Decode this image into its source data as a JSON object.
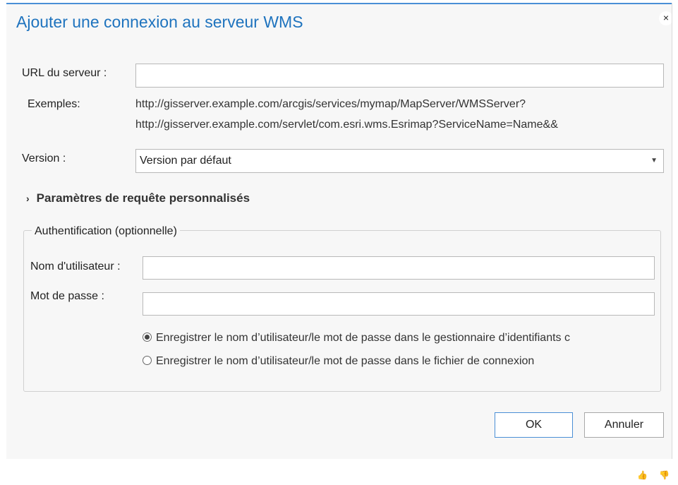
{
  "dialog": {
    "title": "Ajouter une connexion au serveur WMS",
    "close_glyph": "×"
  },
  "url": {
    "label": "URL du serveur :",
    "value": ""
  },
  "examples": {
    "label": "Exemples:",
    "line1": "http://gisserver.example.com/arcgis/services/mymap/MapServer/WMSServer?",
    "line2": "http://gisserver.example.com/servlet/com.esri.wms.Esrimap?ServiceName=Name&&"
  },
  "version": {
    "label": "Version :",
    "selected": "Version par défaut",
    "caret": "▼"
  },
  "custom_params": {
    "chevron": "›",
    "label": "Paramètres de requête personnalisés"
  },
  "auth": {
    "legend": "Authentification (optionnelle)",
    "username_label": "Nom d'utilisateur :",
    "username_value": "",
    "password_label": "Mot de passe :",
    "password_value": "",
    "option1": "Enregistrer le nom d’utilisateur/le mot de passe dans le gestionnaire d’identifiants c",
    "option2": "Enregistrer le nom d’utilisateur/le mot de passe dans le fichier de connexion",
    "selected_option": 1
  },
  "buttons": {
    "ok": "OK",
    "cancel": "Annuler"
  },
  "feedback": {
    "thumbs_up": "👍",
    "thumbs_down": "👎"
  }
}
